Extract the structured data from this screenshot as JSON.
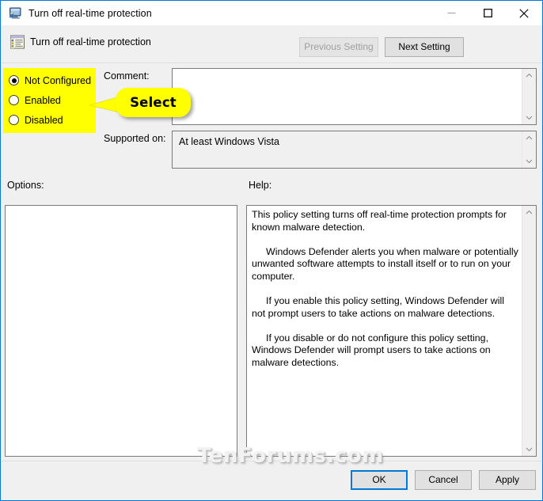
{
  "window": {
    "title": "Turn off real-time protection",
    "icon": "policy-computer-icon",
    "controls": {
      "minimize": "minimize-icon",
      "maximize": "maximize-icon",
      "close": "close-icon"
    },
    "accent_color": "#0078d7",
    "chrome_color": "#f0f0f0"
  },
  "header": {
    "icon": "group-policy-setting-icon",
    "title": "Turn off real-time protection",
    "previous_setting_label": "Previous Setting",
    "previous_setting_enabled": false,
    "next_setting_label": "Next Setting",
    "next_setting_enabled": true
  },
  "state": {
    "options": [
      {
        "label": "Not Configured",
        "selected": true
      },
      {
        "label": "Enabled",
        "selected": false
      },
      {
        "label": "Disabled",
        "selected": false
      }
    ],
    "highlight_color": "#ffff00"
  },
  "callout": {
    "text": "Select",
    "background": "#ffff00"
  },
  "comment": {
    "label": "Comment:",
    "value": "",
    "scroll_up_icon": "chevron-up-icon",
    "scroll_down_icon": "chevron-down-icon"
  },
  "supported_on": {
    "label": "Supported on:",
    "value": "At least Windows Vista",
    "scroll_up_icon": "chevron-up-icon",
    "scroll_down_icon": "chevron-down-icon"
  },
  "options_panel": {
    "label": "Options:",
    "content": ""
  },
  "help_panel": {
    "label": "Help:",
    "paragraphs": [
      "This policy setting turns off real-time protection prompts for known malware detection.",
      "Windows Defender alerts you when malware or potentially unwanted software attempts to install itself or to run on your computer.",
      "If you enable this policy setting, Windows Defender will not prompt users to take actions on malware detections.",
      "If you disable or do not configure this policy setting, Windows Defender will prompt users to take actions on malware detections."
    ],
    "scroll_up_icon": "chevron-up-icon",
    "scroll_down_icon": "chevron-down-icon"
  },
  "footer": {
    "ok_label": "OK",
    "cancel_label": "Cancel",
    "apply_label": "Apply",
    "focused_button": "OK"
  },
  "watermark": {
    "text": "TenForums.com"
  }
}
